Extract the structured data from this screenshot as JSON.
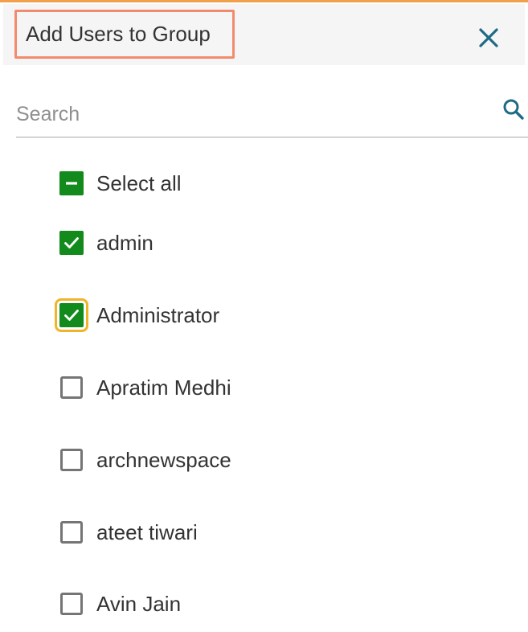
{
  "dialog": {
    "title": "Add Users to Group",
    "close_icon": "close-icon"
  },
  "search": {
    "placeholder": "Search",
    "value": "",
    "icon": "search-icon"
  },
  "select_all": {
    "label": "Select all",
    "state": "indeterminate"
  },
  "users": [
    {
      "label": "admin",
      "checked": true,
      "focused": false
    },
    {
      "label": "Administrator",
      "checked": true,
      "focused": true
    },
    {
      "label": "Apratim Medhi",
      "checked": false,
      "focused": false
    },
    {
      "label": "archnewspace",
      "checked": false,
      "focused": false
    },
    {
      "label": "ateet tiwari",
      "checked": false,
      "focused": false
    },
    {
      "label": "Avin Jain",
      "checked": false,
      "focused": false
    }
  ],
  "colors": {
    "accent_top": "#f0a04b",
    "title_highlight": "#f28b6c",
    "checkbox_checked": "#138a1c",
    "focus_ring": "#f0b429",
    "icon_teal": "#1f6a85"
  }
}
